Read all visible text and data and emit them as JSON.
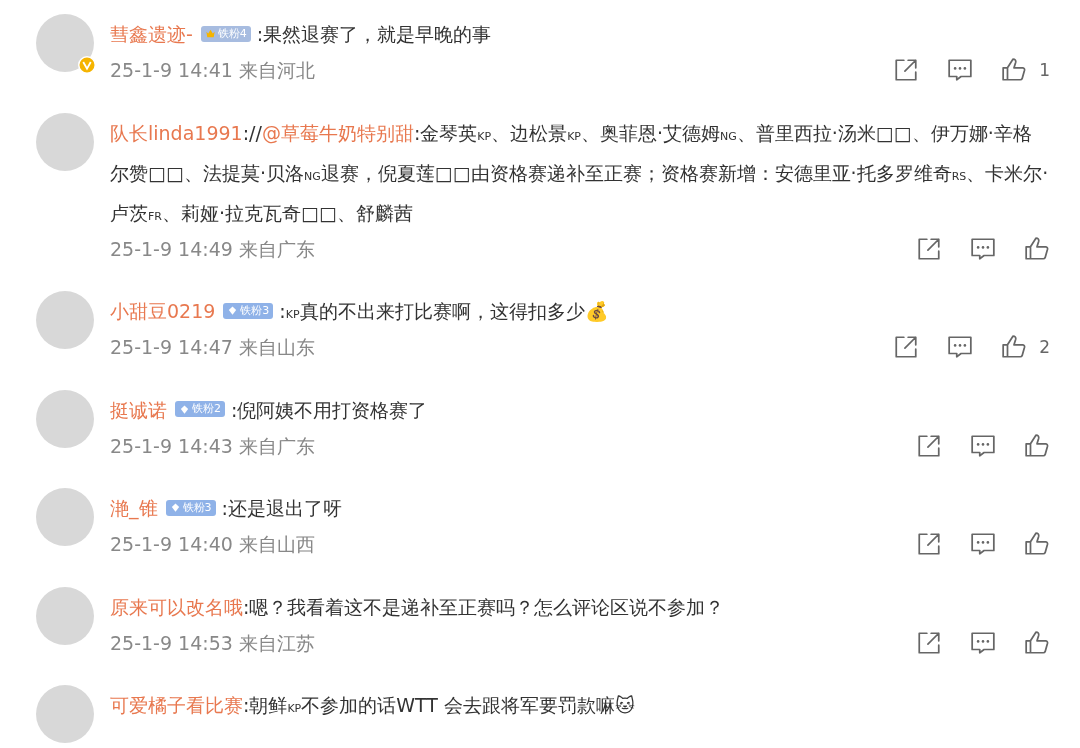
{
  "comments": [
    {
      "verified": true,
      "name": "彗鑫遗迹-",
      "badge": {
        "kind": "gold",
        "text": "铁粉4"
      },
      "text": ":果然退赛了，就是早晚的事",
      "time": "25-1-9 14:41 来自河北",
      "likes": "1"
    },
    {
      "verified": false,
      "name": "队长linda1991",
      "prefix": "://",
      "mention": "@草莓牛奶特别甜",
      "text": ":金琴英$_{KP}$、边松景$_{KP}$、奥菲恩·艾德姆$_{NG}$、普里西拉·汤米□□、伊万娜·辛格尔赞□□、法提莫·贝洛$_{NG}$退赛，倪夏莲□□由资格赛递补至正赛；资格赛新增：安德里亚·托多罗维奇$_{RS}$、卡米尔·卢茨$_{FR}$、莉娅·拉克瓦奇□□、舒麟茜",
      "time": "25-1-9 14:49 来自广东"
    },
    {
      "verified": false,
      "name": "小甜豆0219",
      "badge": {
        "kind": "blue",
        "text": "铁粉3"
      },
      "text": ":$_{KP}$真的不出来打比赛啊，这得扣多少💰",
      "time": "25-1-9 14:47 来自山东",
      "likes": "2"
    },
    {
      "verified": false,
      "name": "挺诚诺",
      "badge": {
        "kind": "blue",
        "text": "铁粉2"
      },
      "text": ":倪阿姨不用打资格赛了",
      "time": "25-1-9 14:43 来自广东"
    },
    {
      "verified": false,
      "name": "滟_锥",
      "badge": {
        "kind": "blue",
        "text": "铁粉3"
      },
      "text": ":还是退出了呀",
      "time": "25-1-9 14:40 来自山西"
    },
    {
      "verified": false,
      "name": "原来可以改名哦",
      "text": ":嗯？我看着这不是递补至正赛吗？怎么评论区说不参加？",
      "time": "25-1-9 14:53 来自江苏"
    },
    {
      "verified": false,
      "name": "可爱橘子看比赛",
      "text": ":朝鲜$_{KP}$不参加的话WTT 会去跟将军要罚款嘛🐱"
    }
  ]
}
